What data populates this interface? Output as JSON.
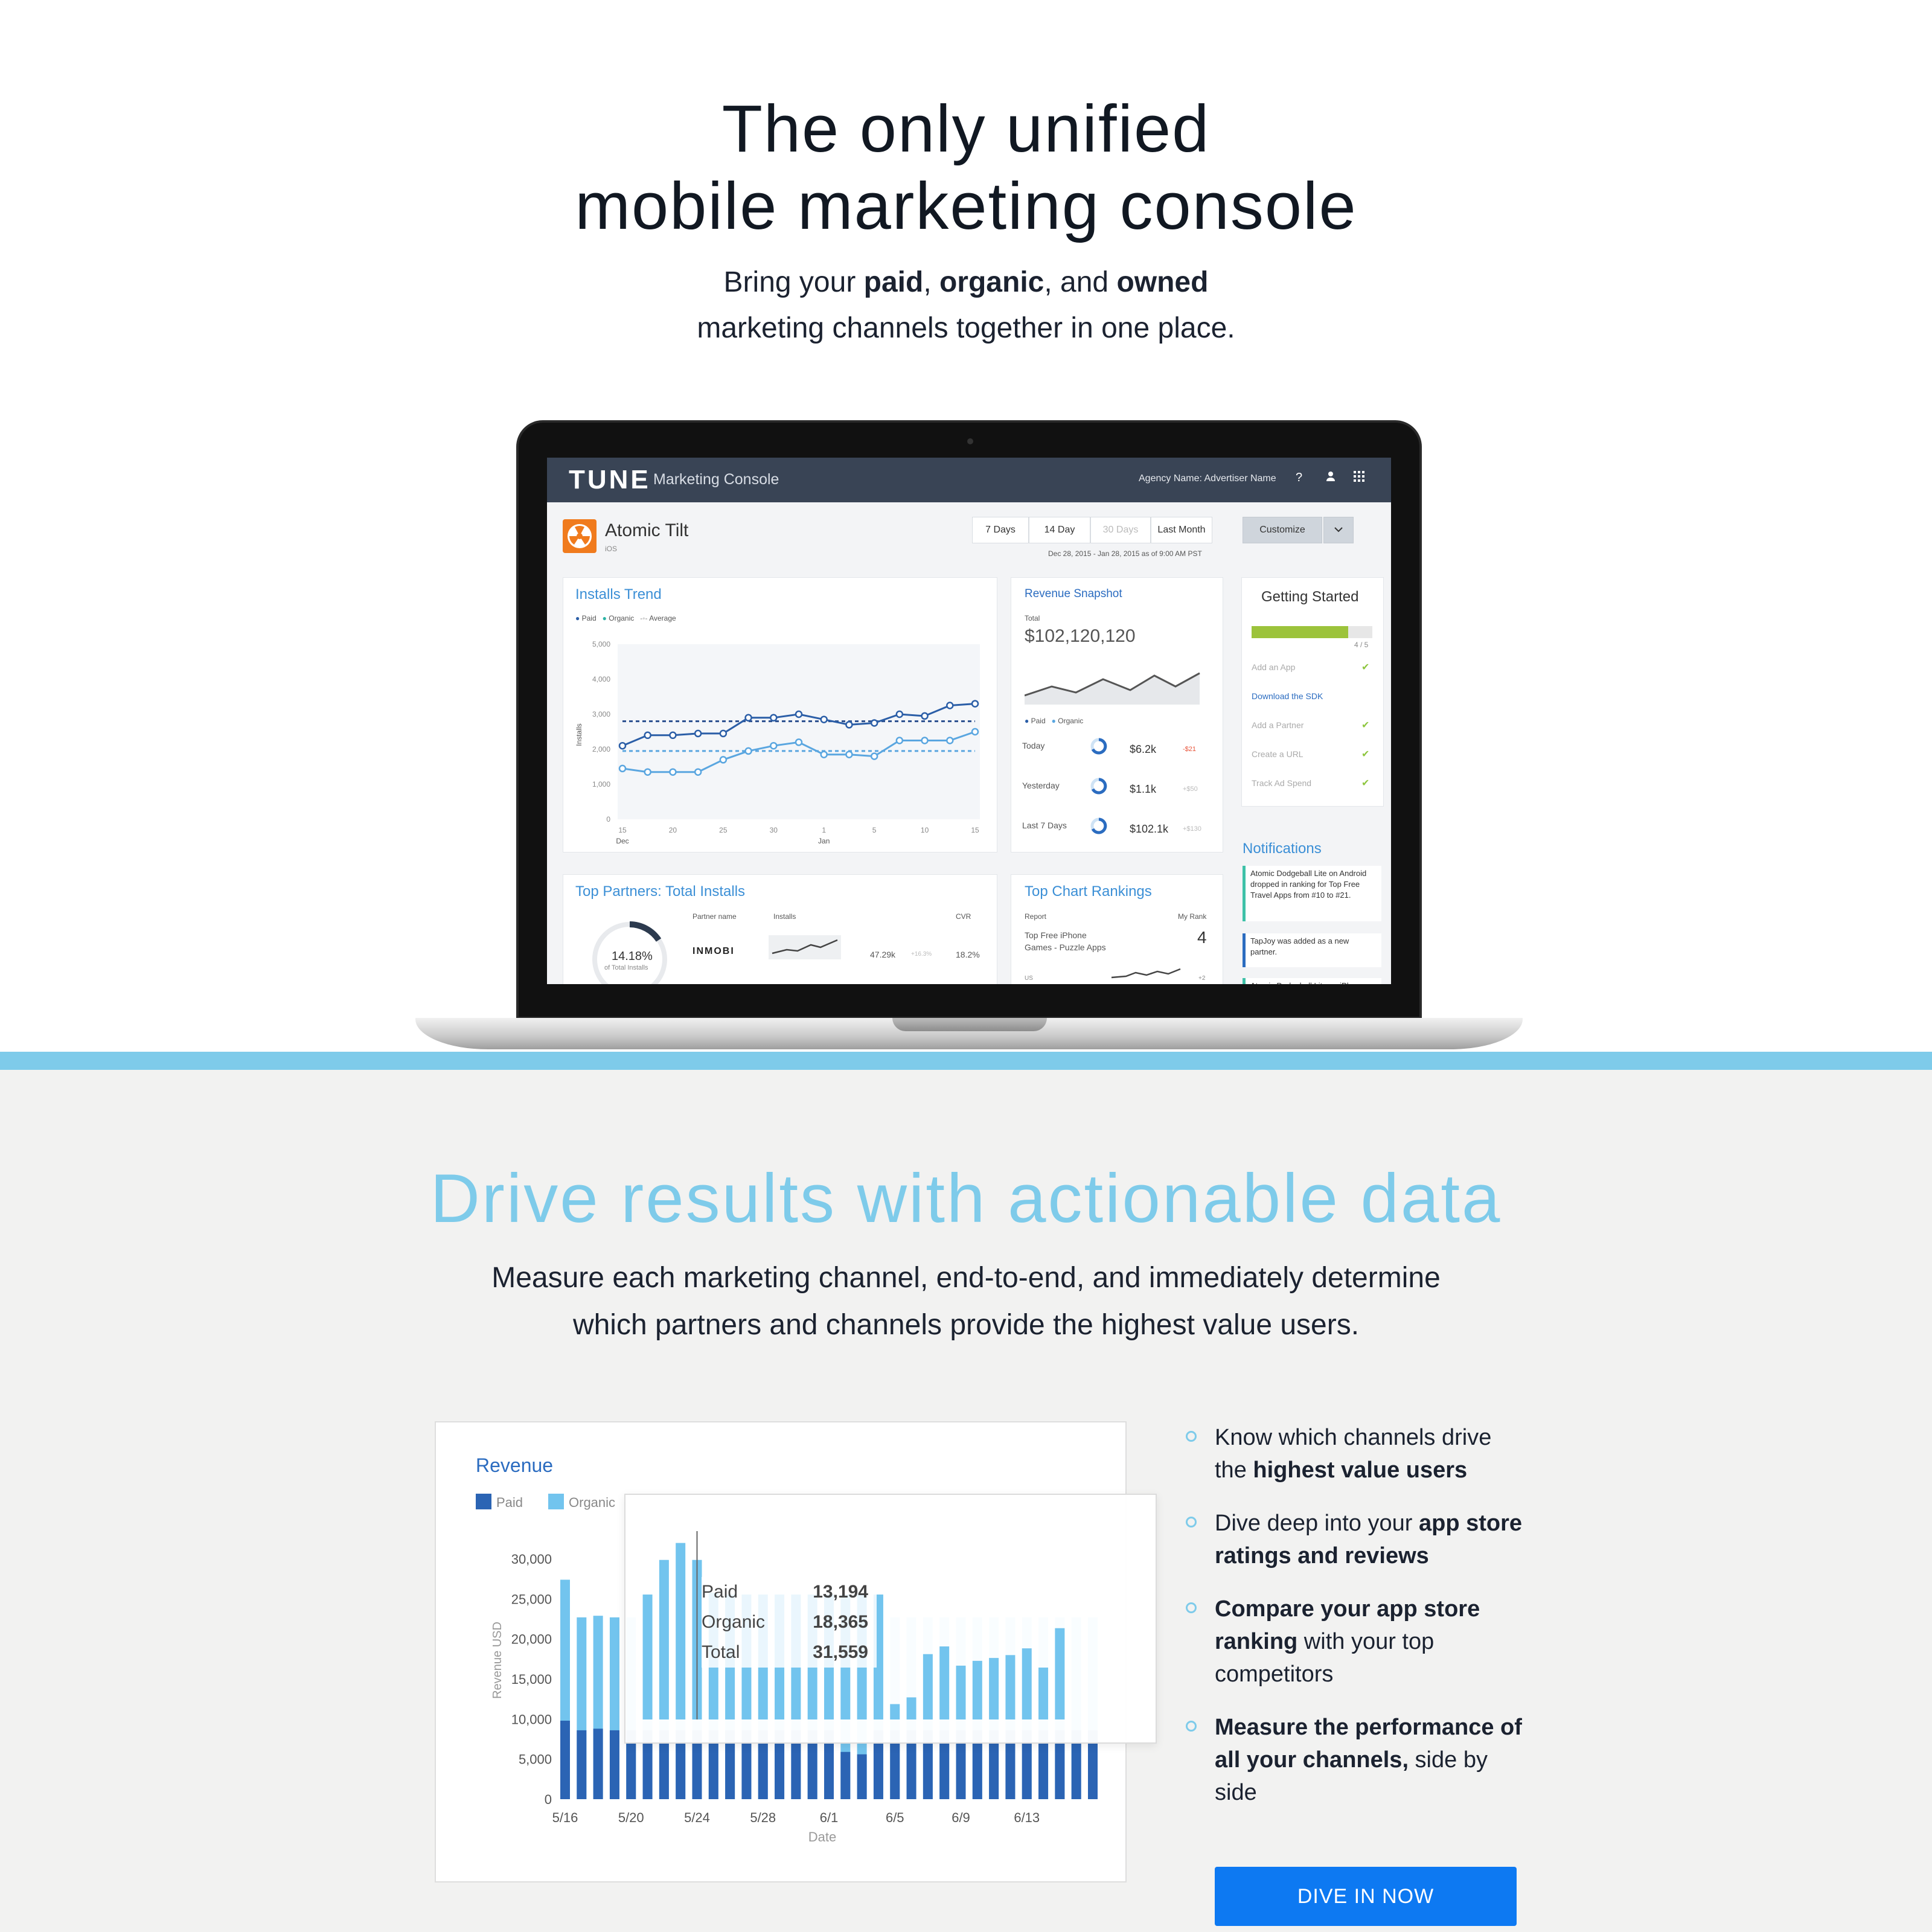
{
  "hero": {
    "title_line1": "The only unified",
    "title_line2": "mobile marketing console",
    "sub_pre": "Bring your ",
    "sub_paid": "paid",
    "sub_comma": ", ",
    "sub_organic": "organic",
    "sub_and": ", and ",
    "sub_owned": "owned",
    "sub_line2": "marketing channels together in one place."
  },
  "console": {
    "logo": "TUNE",
    "product": "Marketing Console",
    "agency": "Agency Name: Advertiser Name",
    "help": "?",
    "app_name": "Atomic Tilt",
    "app_platform": "iOS",
    "ranges": [
      "7 Days",
      "14 Day",
      "30 Days",
      "Last Month"
    ],
    "customize": "Customize",
    "date_range": "Dec 28, 2015 - Jan 28, 2015 as of 9:00 AM PST",
    "installs_trend": {
      "title": "Installs Trend",
      "legend": [
        "Paid",
        "Organic",
        "Average"
      ],
      "ylabel": "Installs",
      "yticks": [
        "5,000",
        "4,000",
        "3,000",
        "2,000",
        "1,000",
        "0"
      ],
      "xticks": [
        "15",
        "20",
        "25",
        "30",
        "1",
        "5",
        "10",
        "15"
      ],
      "xmonths": [
        "Dec",
        "Jan"
      ],
      "paid": [
        2100,
        2400,
        2400,
        2450,
        2450,
        2900,
        2900,
        3000,
        2850,
        2700,
        2750,
        3000,
        2950,
        3250,
        3300
      ],
      "organic": [
        1450,
        1350,
        1350,
        1350,
        1700,
        1950,
        2100,
        2200,
        1850,
        1850,
        1800,
        2250,
        2250,
        2250,
        2500
      ],
      "paid_avg": 2800,
      "organic_avg": 1950
    },
    "revenue_snapshot": {
      "title": "Revenue Snapshot",
      "total_label": "Total",
      "total": "$102,120,120",
      "legend": [
        "Paid",
        "Organic"
      ],
      "rows": [
        {
          "label": "Today",
          "value": "$6.2k",
          "delta": "-$21"
        },
        {
          "label": "Yesterday",
          "value": "$1.1k",
          "delta": "+$50"
        },
        {
          "label": "Last 7 Days",
          "value": "$102.1k",
          "delta": "+$130"
        }
      ]
    },
    "getting_started": {
      "title": "Getting Started",
      "progress": "4 / 5",
      "progress_fraction": 0.8,
      "items": [
        "Add an App",
        "Download the SDK",
        "Add a Partner",
        "Create a URL",
        "Track Ad Spend"
      ],
      "check": "✔"
    },
    "notifications": {
      "title": "Notifications",
      "items": [
        "Atomic Dodgeball Lite on Android dropped in ranking for Top Free Travel Apps from #10 to #21.",
        "TapJoy was added as a new partner.",
        "Atomic Dodgeball Lite on iPhone"
      ]
    },
    "top_partners": {
      "title": "Top Partners: Total Installs",
      "pct": "14.18%",
      "pct_sub": "of Total Installs",
      "cols": [
        "Partner name",
        "Installs",
        "CVR"
      ],
      "partner": "INMOBI",
      "installs": "47.29k",
      "delta": "+16.3%",
      "cvr": "18.2%"
    },
    "top_chart": {
      "title": "Top Chart Rankings",
      "col1": "Report",
      "col2": "My Rank",
      "report": "Top Free iPhone Games - Puzzle Apps",
      "rank": "4",
      "region": "US",
      "change": "+2"
    }
  },
  "section2": {
    "title": "Drive results with actionable data",
    "sub_line1": "Measure each marketing channel, end-to-end, and immediately determine",
    "sub_line2": "which partners and channels provide the highest value users."
  },
  "revenue_chart": {
    "title": "Revenue",
    "legend_paid": "Paid",
    "legend_organic": "Organic",
    "ylabel": "Revenue USD",
    "xlabel": "Date",
    "yticks": [
      "30,000",
      "25,000",
      "20,000",
      "15,000",
      "10,000",
      "5,000",
      "0"
    ],
    "xticks": [
      "5/16",
      "5/20",
      "5/24",
      "5/28",
      "6/1",
      "6/5",
      "6/9",
      "6/13"
    ],
    "tooltip": {
      "paid_label": "Paid",
      "paid": "13,194",
      "organic_label": "Organic",
      "organic": "18,365",
      "total_label": "Total",
      "total": "31,559"
    }
  },
  "chart_data": {
    "type": "bar",
    "title": "Revenue",
    "xlabel": "Date",
    "ylabel": "Revenue USD",
    "ylim": [
      0,
      30000
    ],
    "categories": [
      "5/16",
      "5/17",
      "5/18",
      "5/19",
      "5/20",
      "5/21",
      "5/22",
      "5/23",
      "5/24",
      "5/25",
      "5/26",
      "5/27",
      "5/28",
      "5/29",
      "5/30",
      "5/31",
      "6/1",
      "6/2",
      "6/3",
      "6/4",
      "6/5",
      "6/6",
      "6/7",
      "6/8",
      "6/9",
      "6/10",
      "6/11",
      "6/12",
      "6/13",
      "6/14",
      "6/15",
      "6/16",
      "6/17"
    ],
    "series": [
      {
        "name": "Paid",
        "values": [
          9800,
          8600,
          8800,
          8600,
          8600,
          8600,
          8600,
          8600,
          8600,
          8600,
          8600,
          8600,
          8600,
          8600,
          8600,
          8600,
          8600,
          5900,
          5600,
          8600,
          8600,
          8600,
          8600,
          8600,
          8600,
          8600,
          8600,
          8600,
          8600,
          8600,
          8600,
          8600,
          8600
        ]
      },
      {
        "name": "Organic",
        "values": [
          17600,
          14100,
          14100,
          14100,
          14100,
          14100,
          14100,
          14100,
          14100,
          14100,
          14100,
          14100,
          14100,
          14100,
          14100,
          14100,
          14100,
          14100,
          14100,
          14100,
          14100,
          14100,
          14100,
          14100,
          14100,
          14100,
          14100,
          14100,
          14100,
          14100,
          14100,
          14100,
          14100
        ]
      }
    ],
    "highlight_overlay": {
      "range": [
        "5/21",
        "6/17"
      ],
      "organic_values": [
        13000,
        16600,
        18365,
        16600,
        13194,
        13000,
        13000,
        13000,
        13000,
        13000,
        13000,
        13000,
        13000,
        13000,
        13000,
        1600,
        2300,
        6800,
        7600,
        5600,
        6100,
        6400,
        6700,
        7400,
        5400,
        9500
      ]
    },
    "legend": "top-left",
    "grid": false
  },
  "cta": {
    "label": "DIVE IN NOW"
  },
  "bullets": [
    {
      "pre": "Know which channels drive the ",
      "bold": "highest value users",
      "post": ""
    },
    {
      "pre": "Dive deep into your ",
      "bold": "app store ratings and reviews",
      "post": ""
    },
    {
      "pre": "",
      "bold": "Compare your app store ranking",
      "post": " with your top competitors"
    },
    {
      "pre": "",
      "bold": "Measure the performance of all your channels,",
      "post": " side by side"
    }
  ],
  "colors": {
    "accent": "#7ecbea",
    "paid": "#2b64b4",
    "organic": "#72c4ee",
    "cta": "#0d79f2",
    "topbar": "#394455"
  }
}
